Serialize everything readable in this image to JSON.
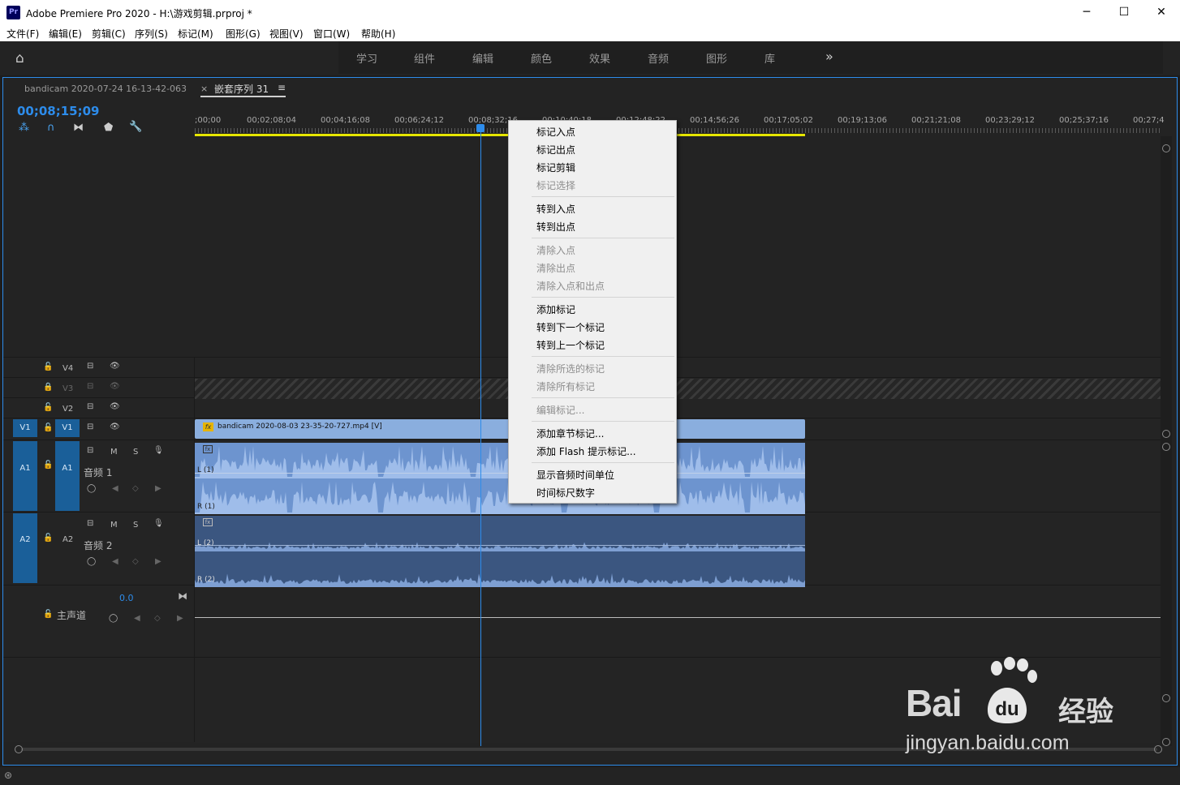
{
  "titlebar": {
    "app_icon": "Pr",
    "title": "Adobe Premiere Pro 2020 - H:\\游戏剪辑.prproj *",
    "minimize": "─",
    "maximize": "☐",
    "close": "✕"
  },
  "menubar": [
    "文件(F)",
    "编辑(E)",
    "剪辑(C)",
    "序列(S)",
    "标记(M)",
    "图形(G)",
    "视图(V)",
    "窗口(W)",
    "帮助(H)"
  ],
  "workspaces": [
    "学习",
    "组件",
    "编辑",
    "颜色",
    "效果",
    "音频",
    "图形",
    "库"
  ],
  "workspace_more": "»",
  "timeline": {
    "tab_source": "bandicam 2020-07-24 16-13-42-063",
    "tab_close": "×",
    "tab_active": "嵌套序列 31",
    "tab_menu": "≡",
    "timecode": "00;08;15;09",
    "ruler_labels": [
      ";00;00",
      "00;02;08;04",
      "00;04;16;08",
      "00;06;24;12",
      "00;08;32;16",
      "00;10;40;18",
      "00;12;48;22",
      "00;14;56;26",
      "00;17;05;02",
      "00;19;13;06",
      "00;21;21;08",
      "00;23;29;12",
      "00;25;37;16",
      "00;27;4"
    ]
  },
  "tracks": {
    "video": [
      {
        "name": "V4",
        "target": ""
      },
      {
        "name": "V3",
        "target": ""
      },
      {
        "name": "V2",
        "target": ""
      },
      {
        "name": "V1",
        "target": "V1"
      }
    ],
    "audio": [
      {
        "src": "A1",
        "target": "A1",
        "label": "音频 1",
        "m": "M",
        "s": "S"
      },
      {
        "src": "A2",
        "target": "A2",
        "label": "音频 2",
        "m": "M",
        "s": "S"
      }
    ],
    "master": {
      "label": "主声道",
      "level": "0.0"
    }
  },
  "clips": {
    "v1": "bandicam 2020-08-03 23-35-20-727.mp4 [V]",
    "fx": "fx",
    "a1_l": "L (1)",
    "a1_r": "R (1)",
    "a2_l": "L (2)",
    "a2_r": "R (2)"
  },
  "context_menu": {
    "items": [
      {
        "label": "标记入点",
        "enabled": true
      },
      {
        "label": "标记出点",
        "enabled": true
      },
      {
        "label": "标记剪辑",
        "enabled": true
      },
      {
        "label": "标记选择",
        "enabled": false
      },
      {
        "label": "转到入点",
        "enabled": true
      },
      {
        "label": "转到出点",
        "enabled": true
      },
      {
        "label": "清除入点",
        "enabled": false
      },
      {
        "label": "清除出点",
        "enabled": false
      },
      {
        "label": "清除入点和出点",
        "enabled": false
      },
      {
        "label": "添加标记",
        "enabled": true
      },
      {
        "label": "转到下一个标记",
        "enabled": true
      },
      {
        "label": "转到上一个标记",
        "enabled": true
      },
      {
        "label": "清除所选的标记",
        "enabled": false
      },
      {
        "label": "清除所有标记",
        "enabled": false
      },
      {
        "label": "编辑标记...",
        "enabled": false
      },
      {
        "label": "添加章节标记...",
        "enabled": true
      },
      {
        "label": "添加 Flash 提示标记...",
        "enabled": true
      },
      {
        "label": "显示音频时间单位",
        "enabled": true
      },
      {
        "label": "时间标尺数字",
        "enabled": true
      }
    ]
  },
  "watermark": {
    "brand": "Bai",
    "brand2": "经验",
    "url": "jingyan.baidu.com"
  },
  "colors": {
    "accent": "#2d8ceb",
    "clip_video": "#8aaede",
    "clip_audio": "#6d94cf",
    "work_area": "#e6e600"
  }
}
